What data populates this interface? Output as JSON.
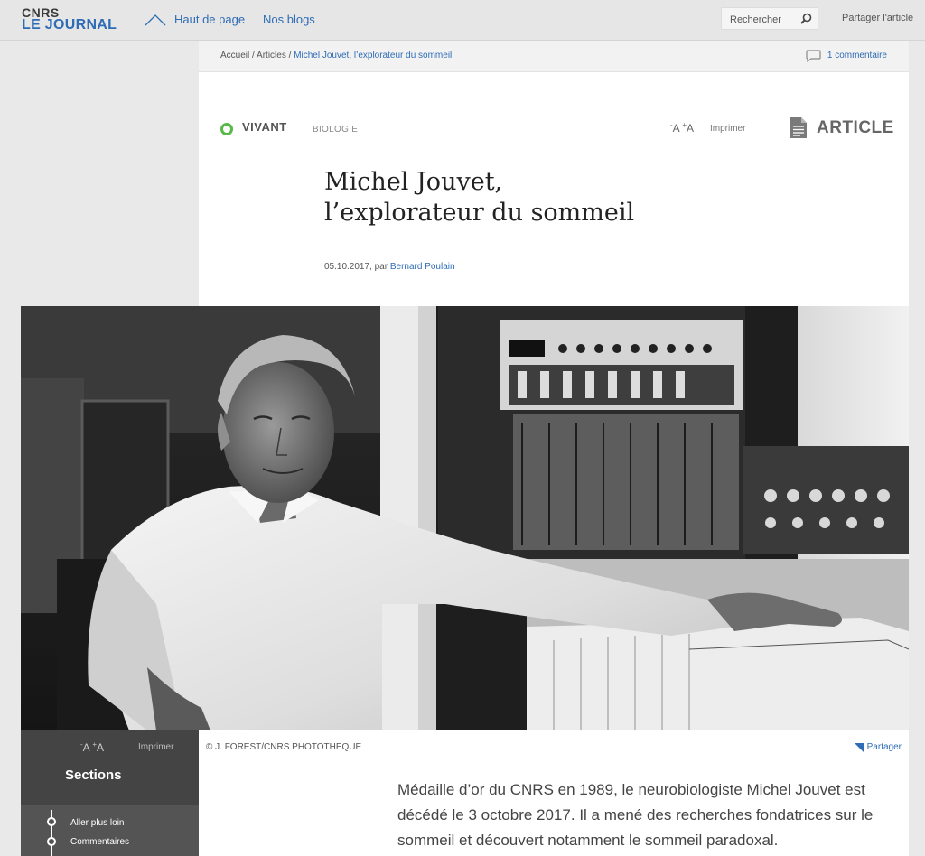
{
  "header": {
    "logo_top": "CNRS",
    "logo_bottom": "LE JOURNAL",
    "nav": [
      "Haut de page",
      "Nos blogs"
    ],
    "search_placeholder": "Rechercher",
    "share": "Partager l'article"
  },
  "breadcrumb": {
    "home": "Accueil",
    "sep": " / ",
    "section": "Articles",
    "current": "Michel Jouvet, l’explorateur du sommeil"
  },
  "comments": "1 commentaire",
  "article": {
    "rubric": "VIVANT",
    "subrubric": "BIOLOGIE",
    "font_decrease": "-A",
    "font_increase": "+A",
    "print": "Imprimer",
    "type": "ARTICLE",
    "title_line1": "Michel Jouvet,",
    "title_line2": "l’explorateur du sommeil",
    "date": "05.10.2017, par ",
    "author": "Bernard Poulain",
    "photo_credit": "© J. FOREST/CNRS PHOTOTHEQUE",
    "photo_share": "Partager",
    "lead": "Médaille d’or du CNRS en 1989, le neurobiologiste Michel Jouvet est décédé le 3 octobre 2017. Il a mené des recherches fondatrices sur le sommeil et découvert notamment le sommeil paradoxal."
  },
  "sidebar": {
    "font_decrease": "-A",
    "font_increase": "+A",
    "print": "Imprimer",
    "title": "Sections",
    "items": [
      "Aller plus loin",
      "Commentaires"
    ]
  },
  "colors": {
    "accent_blue": "#2e6cb5",
    "rubric_green": "#57b947",
    "sidebar_dark": "#3b3b3b"
  }
}
